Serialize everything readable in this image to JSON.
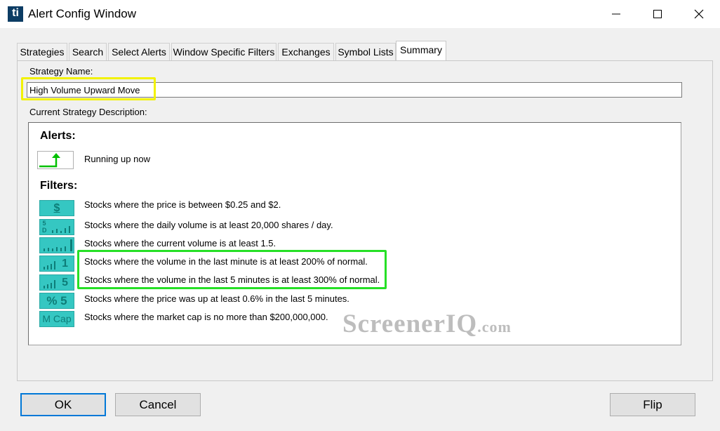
{
  "window": {
    "title": "Alert Config Window",
    "app_icon": "ti",
    "controls": [
      "minimize-icon",
      "maximize-icon",
      "close-icon"
    ]
  },
  "tabs": [
    {
      "label": "Strategies",
      "active": false
    },
    {
      "label": "Search",
      "active": false
    },
    {
      "label": "Select Alerts",
      "active": false
    },
    {
      "label": "Window Specific Filters",
      "active": false
    },
    {
      "label": "Exchanges",
      "active": false
    },
    {
      "label": "Symbol Lists",
      "active": false
    },
    {
      "label": "Summary",
      "active": true
    }
  ],
  "summary": {
    "strategy_name_label": "Strategy Name:",
    "strategy_name_value": "High Volume Upward Move",
    "description_label": "Current Strategy Description:",
    "alerts_heading": "Alerts:",
    "alerts": [
      {
        "icon": "running-up-icon",
        "text": "Running up now"
      }
    ],
    "filters_heading": "Filters:",
    "filters": [
      {
        "icon_text": "$",
        "text": "Stocks where the price is between $0.25 and $2."
      },
      {
        "icon_text": "5 D",
        "text": "Stocks where the daily volume is at least 20,000 shares / day."
      },
      {
        "icon_text": "",
        "text": "Stocks where the current volume is at least 1.5."
      },
      {
        "icon_text": "1",
        "text": "Stocks where the volume in the last minute is at least 200% of normal."
      },
      {
        "icon_text": "5",
        "text": "Stocks where the volume in the last 5 minutes is at least 300% of normal."
      },
      {
        "icon_text": "% 5",
        "text": "Stocks where the price was up at least 0.6% in the last 5 minutes."
      },
      {
        "icon_text": "M Cap",
        "text": "Stocks where the market cap is no more than $200,000,000."
      }
    ]
  },
  "watermark": {
    "main": "ScreenerIQ",
    "suffix": ".com"
  },
  "buttons": {
    "ok": "OK",
    "cancel": "Cancel",
    "flip": "Flip"
  },
  "colors": {
    "highlight_name": "#f2f200",
    "highlight_filters": "#26e026",
    "filter_icon_bg": "#35c7c2",
    "default_button_border": "#0078d7"
  }
}
